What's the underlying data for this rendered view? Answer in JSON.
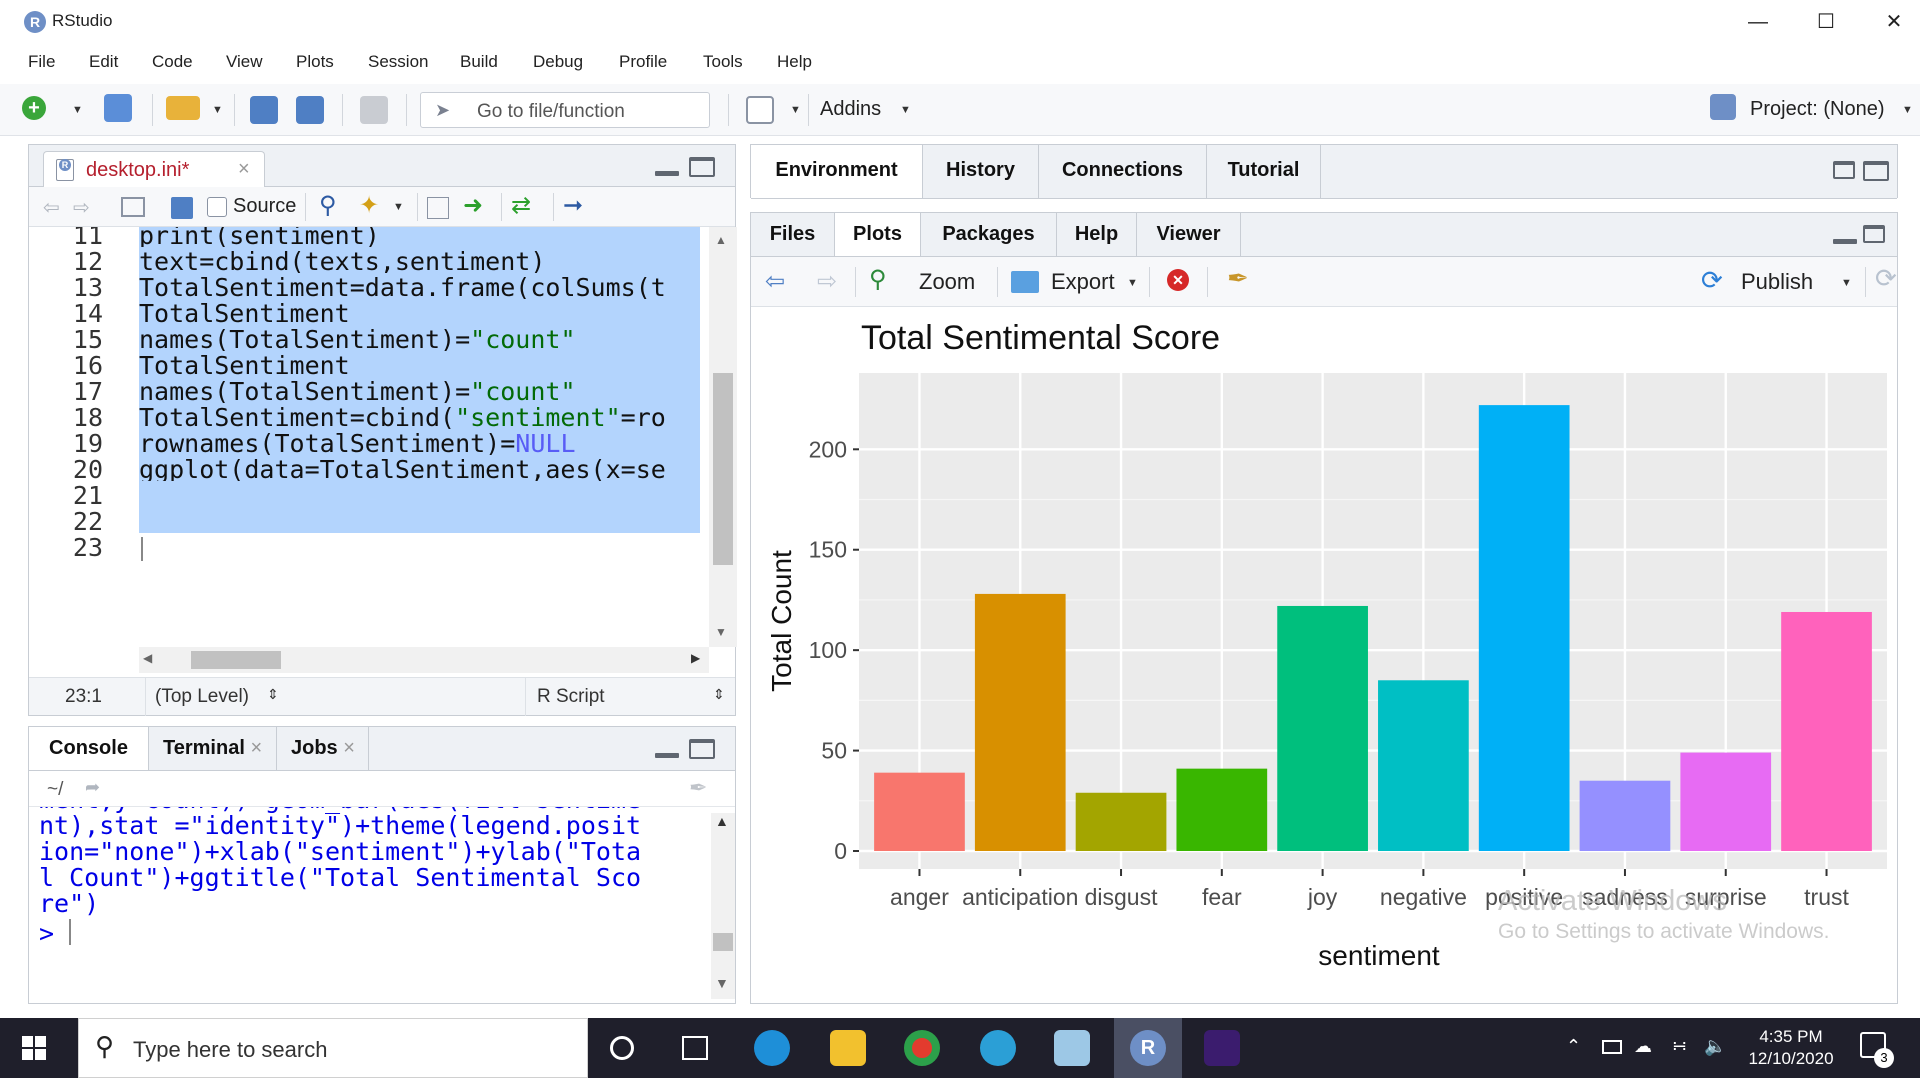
{
  "window": {
    "title": "RStudio"
  },
  "menu": [
    "File",
    "Edit",
    "Code",
    "View",
    "Plots",
    "Session",
    "Build",
    "Debug",
    "Profile",
    "Tools",
    "Help"
  ],
  "toolbar": {
    "goto_placeholder": "Go to file/function",
    "addins_label": "Addins",
    "project_label": "Project: (None)"
  },
  "editor": {
    "tab_name": "desktop.ini*",
    "source_label": "Source",
    "lines": [
      {
        "num": "11",
        "text": "print(sentiment)"
      },
      {
        "num": "12",
        "text": "text=cbind(texts,sentiment)"
      },
      {
        "num": "13",
        "text": "TotalSentiment=data.frame(colSums(t"
      },
      {
        "num": "14",
        "text": "TotalSentiment"
      },
      {
        "num": "15",
        "text": "names(TotalSentiment)=\"count\""
      },
      {
        "num": "16",
        "text": "TotalSentiment"
      },
      {
        "num": "17",
        "text": "names(TotalSentiment)=\"count\""
      },
      {
        "num": "18",
        "text": "TotalSentiment=cbind(\"sentiment\"=ro"
      },
      {
        "num": "19",
        "text": "rownames(TotalSentiment)=NULL"
      },
      {
        "num": "20",
        "text": "ggplot(data=TotalSentiment,aes(x=se"
      },
      {
        "num": "21",
        "text": ""
      },
      {
        "num": "22",
        "text": ""
      },
      {
        "num": "23",
        "text": ""
      }
    ],
    "status_position": "23:1",
    "status_scope": "(Top Level)",
    "status_type": "R Script"
  },
  "console": {
    "tabs": [
      "Console",
      "Terminal",
      "Jobs"
    ],
    "path": "~/",
    "lines": [
      "ment,y=count))+geom_bar(aes(fill=sentime",
      "nt),stat =\"identity\")+theme(legend.posit",
      "ion=\"none\")+xlab(\"sentiment\")+ylab(\"Tota",
      "l Count\")+ggtitle(\"Total Sentimental Sco",
      "re\")"
    ],
    "prompt": ">"
  },
  "env_tabs": [
    "Environment",
    "History",
    "Connections",
    "Tutorial"
  ],
  "files_tabs": [
    "Files",
    "Plots",
    "Packages",
    "Help",
    "Viewer"
  ],
  "plot_toolbar": {
    "zoom": "Zoom",
    "export": "Export",
    "publish": "Publish"
  },
  "chart_data": {
    "type": "bar",
    "title": "Total Sentimental Score",
    "xlabel": "sentiment",
    "ylabel": "Total Count",
    "categories": [
      "anger",
      "anticipation",
      "disgust",
      "fear",
      "joy",
      "negative",
      "positive",
      "sadness",
      "surprise",
      "trust"
    ],
    "values": [
      39,
      128,
      29,
      41,
      122,
      85,
      222,
      35,
      49,
      119
    ],
    "colors": [
      "#F8766D",
      "#D89000",
      "#A3A500",
      "#39B600",
      "#00BF7D",
      "#00BFC4",
      "#00B0F6",
      "#9590FF",
      "#E76BF3",
      "#FF62BC"
    ],
    "ylim": [
      0,
      235
    ],
    "yticks": [
      0,
      50,
      100,
      150,
      200
    ],
    "grid": true,
    "legend": "none"
  },
  "watermark": {
    "line1": "Activate Windows",
    "line2": "Go to Settings to activate Windows."
  },
  "taskbar": {
    "search_placeholder": "Type here to search",
    "time": "4:35 PM",
    "date": "12/10/2020",
    "notif_count": "3"
  }
}
